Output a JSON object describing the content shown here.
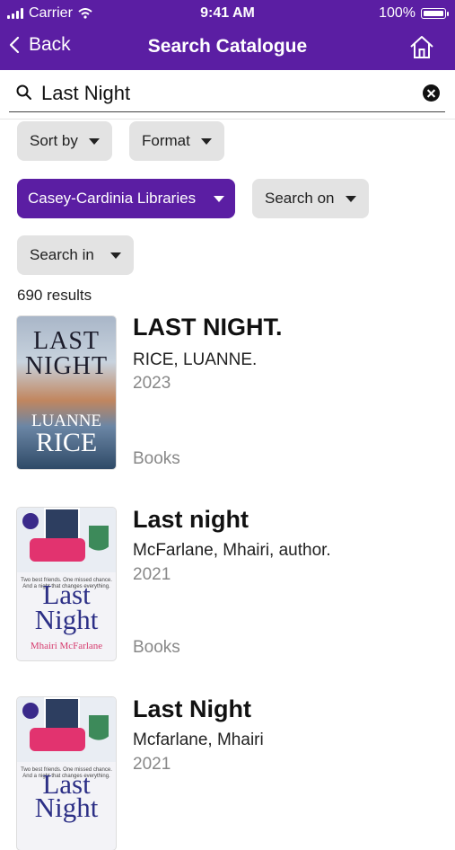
{
  "status_bar": {
    "carrier": "Carrier",
    "time": "9:41 AM",
    "battery": "100%"
  },
  "nav": {
    "back_label": "Back",
    "title": "Search Catalogue"
  },
  "search": {
    "query": "Last Night"
  },
  "filters": {
    "sort_by": "Sort by",
    "format": "Format",
    "library": "Casey-Cardinia Libraries",
    "search_on": "Search on",
    "search_in": "Search in"
  },
  "results_count": "690 results",
  "results": [
    {
      "title": "LAST NIGHT.",
      "author": "RICE, LUANNE.",
      "year": "2023",
      "format": "Books",
      "cover": {
        "line1": "LAST",
        "line2": "NIGHT",
        "author1": "LUANNE",
        "author2": "RICE"
      }
    },
    {
      "title": "Last night",
      "author": "McFarlane, Mhairi, author.",
      "year": "2021",
      "format": "Books",
      "cover": {
        "blurb": "Two best friends. One missed chance. And a night that changes everything.",
        "line1": "Last",
        "line2": "Night",
        "author": "Mhairi McFarlane"
      }
    },
    {
      "title": "Last Night",
      "author": "Mcfarlane, Mhairi",
      "year": "2021",
      "cover": {
        "blurb": "Two best friends. One missed chance. And a night that changes everything.",
        "line1": "Last",
        "line2": "Night"
      }
    }
  ],
  "colors": {
    "brand": "#5b1ea3",
    "chip": "#e3e3e3"
  }
}
